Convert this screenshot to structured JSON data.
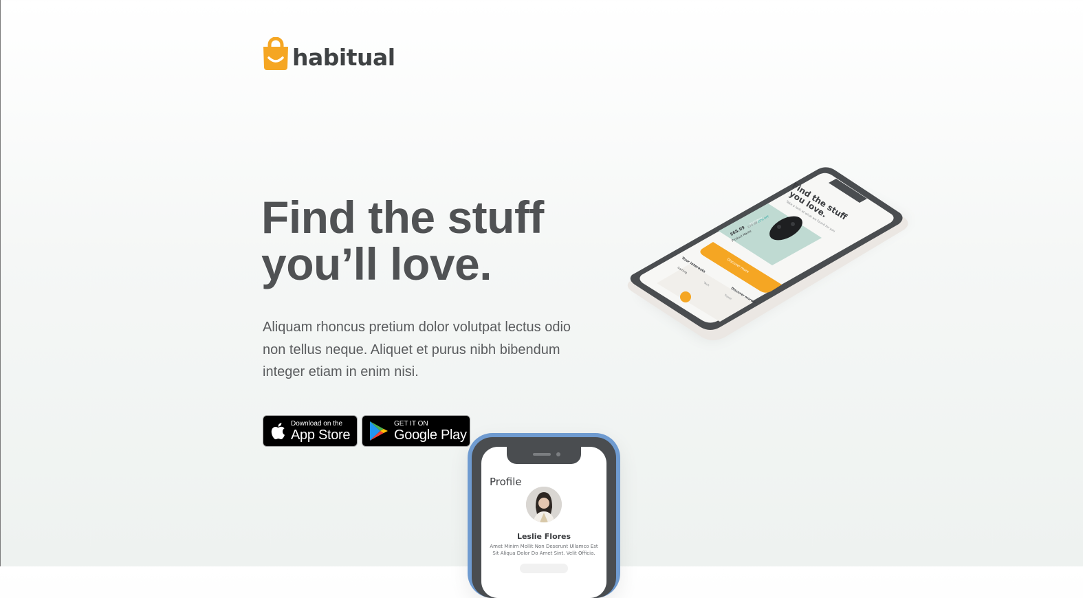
{
  "brand": {
    "name": "habitual",
    "accent_color": "#F5A623",
    "text_color": "#3F4244"
  },
  "hero": {
    "title_line1": "Find the stuff",
    "title_line2": "you’ll love.",
    "description": "Aliquam rhoncus pretium dolor volutpat lectus odio non tellus neque. Aliquet et purus nibh bibendum integer etiam in enim nisi."
  },
  "badges": {
    "apple": {
      "small": "Download on the",
      "big": "App Store",
      "icon": "apple-icon"
    },
    "google": {
      "small": "GET IT ON",
      "big": "Google Play",
      "icon": "google-play-icon"
    }
  },
  "iso_phone": {
    "screen_title_line1": "Find the stuff",
    "screen_title_line2": "you love.",
    "screen_subtitle": "Take a look at what we found for you",
    "product_price": "$65.99",
    "product_old_price": "$79.99",
    "product_discount": "20% OFF",
    "product_badge": "BEST PICK",
    "product_name": "Product Name",
    "cta_label": "Discover more",
    "interests_label": "Your interests",
    "discover_more": "Discover more >",
    "tabs": [
      "Gaming",
      "Tech",
      "Travel"
    ],
    "frame_color": "#4A4D50",
    "card_color": "#BFDAD2",
    "cta_color": "#F5A623"
  },
  "profile_phone": {
    "title": "Profile",
    "name": "Leslie Flores",
    "bio": "Amet Minim Mollit Non Deserunt Ullamco Est Sit Aliqua Dolor Do Amet Sint. Velit Officia.",
    "case_color": "#6F9BD0"
  }
}
